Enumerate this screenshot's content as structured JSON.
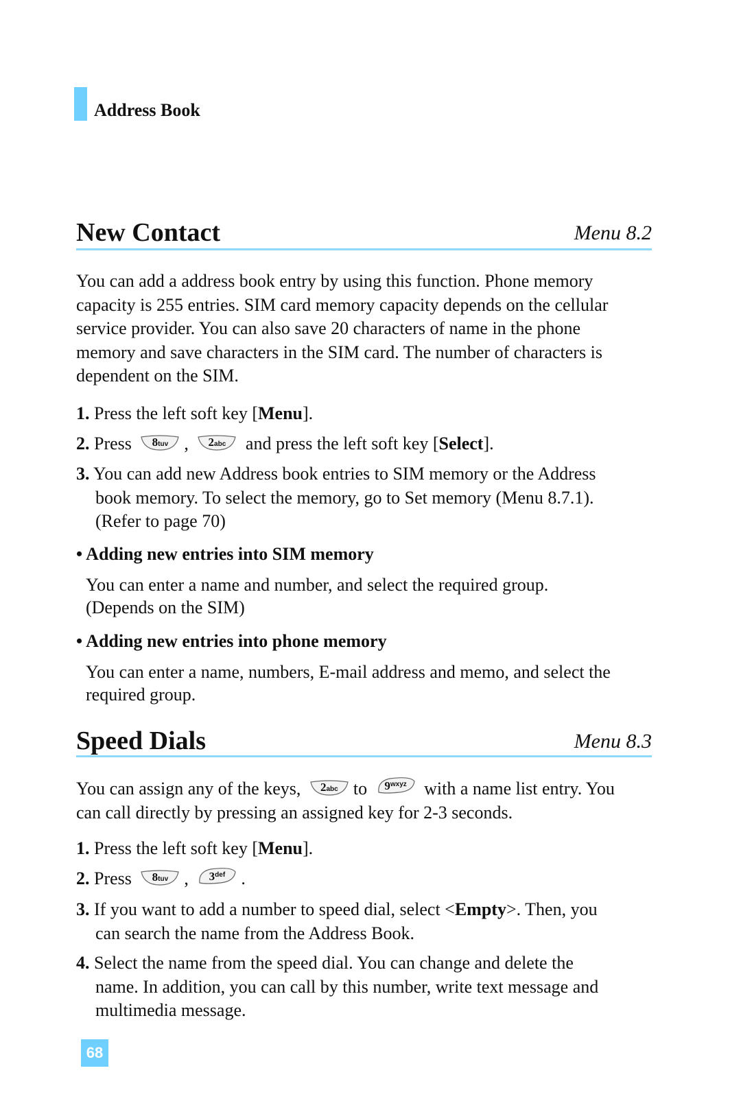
{
  "header": {
    "section_label": "Address Book"
  },
  "new_contact": {
    "title": "New Contact",
    "menu_ref": "Menu 8.2",
    "intro_lines": [
      "You can add a address book entry by using this function. Phone memory",
      "capacity is 255 entries. SIM card memory capacity depends on the cellular",
      "service provider. You can also save 20 characters of name in the phone",
      "memory and save characters in the SIM card. The number of characters is",
      "dependent on the SIM."
    ],
    "steps": {
      "s1": {
        "num": "1.",
        "pre": "Press the left soft key [",
        "bold": "Menu",
        "post": "]."
      },
      "s2": {
        "num": "2.",
        "pre": "Press",
        "sep": ",",
        "post_a": "and press the left soft key [",
        "bold": "Select",
        "post_b": "]."
      },
      "s3": {
        "num": "3.",
        "lines": [
          "You can add new Address book entries to SIM memory or the Address",
          "book memory. To select the memory, go to Set memory (Menu 8.7.1).",
          "(Refer to page 70)"
        ]
      }
    },
    "bullets": [
      {
        "heading": "• Adding new entries into SIM memory",
        "lines": [
          "You can enter a name and number, and select the required group.",
          "(Depends on the SIM)"
        ]
      },
      {
        "heading": "• Adding new entries into phone memory",
        "lines": [
          "You can enter a name, numbers, E-mail address and memo, and select the",
          "required group."
        ]
      }
    ]
  },
  "speed_dials": {
    "title": "Speed Dials",
    "menu_ref": "Menu 8.3",
    "intro": {
      "pre": "You can assign any of the keys,",
      "mid": "to",
      "post": "with a name list entry. You",
      "line2": "can call directly by pressing an assigned key for 2-3 seconds."
    },
    "steps": {
      "s1": {
        "num": "1.",
        "pre": "Press the left soft key [",
        "bold": "Menu",
        "post": "]."
      },
      "s2": {
        "num": "2.",
        "pre": "Press",
        "sep": ",",
        "post": "."
      },
      "s3": {
        "num": "3.",
        "pre": "If you want to add a number to speed dial, select <",
        "bold": "Empty",
        "post": ">. Then, you",
        "line2": "can search the name from the Address Book."
      },
      "s4": {
        "num": "4.",
        "lines": [
          "Select the name from the speed dial. You can change and delete the",
          "name. In addition, you can call by this number, write text message and",
          "multimedia message."
        ]
      }
    }
  },
  "keys": {
    "k8": {
      "digit": "8",
      "letters": "tuv",
      "icon": "keypad-8-icon"
    },
    "k2": {
      "digit": "2",
      "letters": "abc",
      "icon": "keypad-2-icon"
    },
    "k9": {
      "digit": "9",
      "letters": "wxyz",
      "icon": "keypad-9-icon"
    },
    "k3": {
      "digit": "3",
      "letters": "def",
      "icon": "keypad-3-icon"
    }
  },
  "footer": {
    "page_number": "68"
  },
  "colors": {
    "accent": "#6FD0FF",
    "rule": "#8ED8FA"
  }
}
